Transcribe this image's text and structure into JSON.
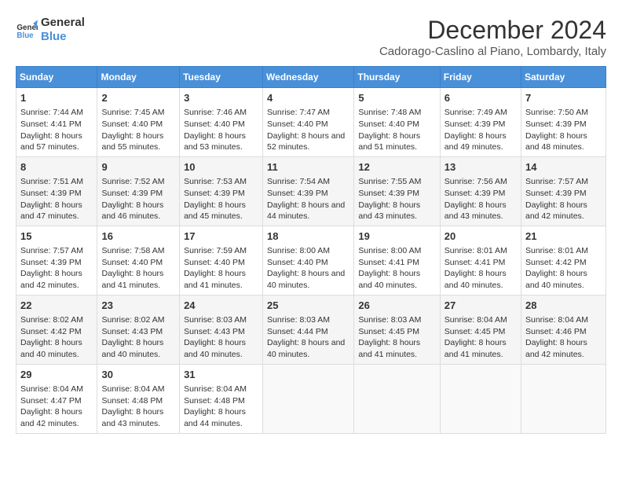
{
  "logo": {
    "line1": "General",
    "line2": "Blue"
  },
  "title": "December 2024",
  "location": "Cadorago-Caslino al Piano, Lombardy, Italy",
  "days_of_week": [
    "Sunday",
    "Monday",
    "Tuesday",
    "Wednesday",
    "Thursday",
    "Friday",
    "Saturday"
  ],
  "weeks": [
    [
      {
        "day": "1",
        "sunrise": "7:44 AM",
        "sunset": "4:41 PM",
        "daylight": "8 hours and 57 minutes."
      },
      {
        "day": "2",
        "sunrise": "7:45 AM",
        "sunset": "4:40 PM",
        "daylight": "8 hours and 55 minutes."
      },
      {
        "day": "3",
        "sunrise": "7:46 AM",
        "sunset": "4:40 PM",
        "daylight": "8 hours and 53 minutes."
      },
      {
        "day": "4",
        "sunrise": "7:47 AM",
        "sunset": "4:40 PM",
        "daylight": "8 hours and 52 minutes."
      },
      {
        "day": "5",
        "sunrise": "7:48 AM",
        "sunset": "4:40 PM",
        "daylight": "8 hours and 51 minutes."
      },
      {
        "day": "6",
        "sunrise": "7:49 AM",
        "sunset": "4:39 PM",
        "daylight": "8 hours and 49 minutes."
      },
      {
        "day": "7",
        "sunrise": "7:50 AM",
        "sunset": "4:39 PM",
        "daylight": "8 hours and 48 minutes."
      }
    ],
    [
      {
        "day": "8",
        "sunrise": "7:51 AM",
        "sunset": "4:39 PM",
        "daylight": "8 hours and 47 minutes."
      },
      {
        "day": "9",
        "sunrise": "7:52 AM",
        "sunset": "4:39 PM",
        "daylight": "8 hours and 46 minutes."
      },
      {
        "day": "10",
        "sunrise": "7:53 AM",
        "sunset": "4:39 PM",
        "daylight": "8 hours and 45 minutes."
      },
      {
        "day": "11",
        "sunrise": "7:54 AM",
        "sunset": "4:39 PM",
        "daylight": "8 hours and 44 minutes."
      },
      {
        "day": "12",
        "sunrise": "7:55 AM",
        "sunset": "4:39 PM",
        "daylight": "8 hours and 43 minutes."
      },
      {
        "day": "13",
        "sunrise": "7:56 AM",
        "sunset": "4:39 PM",
        "daylight": "8 hours and 43 minutes."
      },
      {
        "day": "14",
        "sunrise": "7:57 AM",
        "sunset": "4:39 PM",
        "daylight": "8 hours and 42 minutes."
      }
    ],
    [
      {
        "day": "15",
        "sunrise": "7:57 AM",
        "sunset": "4:39 PM",
        "daylight": "8 hours and 42 minutes."
      },
      {
        "day": "16",
        "sunrise": "7:58 AM",
        "sunset": "4:40 PM",
        "daylight": "8 hours and 41 minutes."
      },
      {
        "day": "17",
        "sunrise": "7:59 AM",
        "sunset": "4:40 PM",
        "daylight": "8 hours and 41 minutes."
      },
      {
        "day": "18",
        "sunrise": "8:00 AM",
        "sunset": "4:40 PM",
        "daylight": "8 hours and 40 minutes."
      },
      {
        "day": "19",
        "sunrise": "8:00 AM",
        "sunset": "4:41 PM",
        "daylight": "8 hours and 40 minutes."
      },
      {
        "day": "20",
        "sunrise": "8:01 AM",
        "sunset": "4:41 PM",
        "daylight": "8 hours and 40 minutes."
      },
      {
        "day": "21",
        "sunrise": "8:01 AM",
        "sunset": "4:42 PM",
        "daylight": "8 hours and 40 minutes."
      }
    ],
    [
      {
        "day": "22",
        "sunrise": "8:02 AM",
        "sunset": "4:42 PM",
        "daylight": "8 hours and 40 minutes."
      },
      {
        "day": "23",
        "sunrise": "8:02 AM",
        "sunset": "4:43 PM",
        "daylight": "8 hours and 40 minutes."
      },
      {
        "day": "24",
        "sunrise": "8:03 AM",
        "sunset": "4:43 PM",
        "daylight": "8 hours and 40 minutes."
      },
      {
        "day": "25",
        "sunrise": "8:03 AM",
        "sunset": "4:44 PM",
        "daylight": "8 hours and 40 minutes."
      },
      {
        "day": "26",
        "sunrise": "8:03 AM",
        "sunset": "4:45 PM",
        "daylight": "8 hours and 41 minutes."
      },
      {
        "day": "27",
        "sunrise": "8:04 AM",
        "sunset": "4:45 PM",
        "daylight": "8 hours and 41 minutes."
      },
      {
        "day": "28",
        "sunrise": "8:04 AM",
        "sunset": "4:46 PM",
        "daylight": "8 hours and 42 minutes."
      }
    ],
    [
      {
        "day": "29",
        "sunrise": "8:04 AM",
        "sunset": "4:47 PM",
        "daylight": "8 hours and 42 minutes."
      },
      {
        "day": "30",
        "sunrise": "8:04 AM",
        "sunset": "4:48 PM",
        "daylight": "8 hours and 43 minutes."
      },
      {
        "day": "31",
        "sunrise": "8:04 AM",
        "sunset": "4:48 PM",
        "daylight": "8 hours and 44 minutes."
      },
      null,
      null,
      null,
      null
    ]
  ],
  "labels": {
    "sunrise": "Sunrise:",
    "sunset": "Sunset:",
    "daylight": "Daylight:"
  }
}
